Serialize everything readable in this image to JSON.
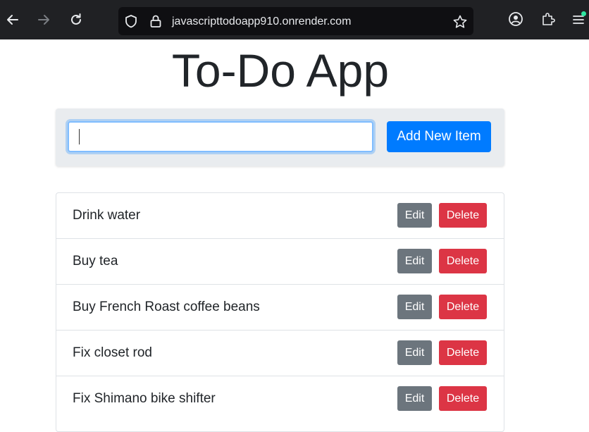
{
  "browser": {
    "url": "javascripttodoapp910.onrender.com",
    "icons": {
      "back": "back-arrow-icon",
      "forward": "forward-arrow-icon",
      "reload": "reload-icon",
      "shield": "shield-icon",
      "lock": "lock-icon",
      "bookmark": "star-icon",
      "account": "account-icon",
      "extensions": "puzzle-icon",
      "menu": "hamburger-menu-icon"
    },
    "colors": {
      "toolbar": "#202124",
      "urlbar": "#0f0f12",
      "extension_badge": "#2ee6a0"
    }
  },
  "app": {
    "title": "To-Do App",
    "input": {
      "value": "",
      "placeholder": ""
    },
    "add_button_label": "Add New Item",
    "items": [
      {
        "text": "Drink water",
        "edit_label": "Edit",
        "delete_label": "Delete"
      },
      {
        "text": "Buy tea",
        "edit_label": "Edit",
        "delete_label": "Delete"
      },
      {
        "text": "Buy French Roast coffee beans",
        "edit_label": "Edit",
        "delete_label": "Delete"
      },
      {
        "text": "Fix closet rod",
        "edit_label": "Edit",
        "delete_label": "Delete"
      },
      {
        "text": "Fix Shimano bike shifter",
        "edit_label": "Edit",
        "delete_label": "Delete"
      }
    ],
    "colors": {
      "primary": "#007bff",
      "secondary": "#6c757d",
      "danger": "#dc3545",
      "panel": "#e9ecef",
      "text": "#212529"
    }
  }
}
